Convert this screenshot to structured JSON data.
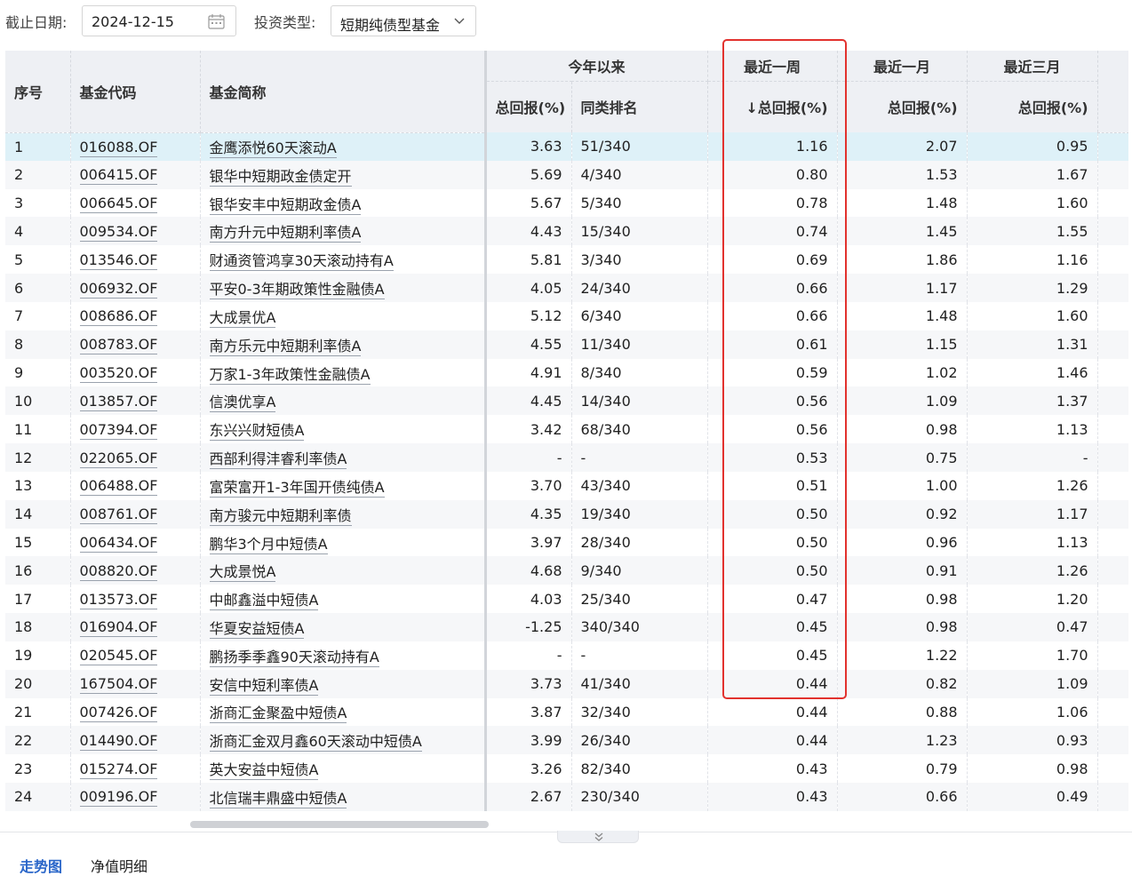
{
  "filters": {
    "date_label": "截止日期:",
    "date_value": "2024-12-15",
    "type_label": "投资类型:",
    "type_value": "短期纯债型基金"
  },
  "header": {
    "col_index": "序号",
    "col_code": "基金代码",
    "col_name": "基金简称",
    "group_ytd": "今年以来",
    "group_week": "最近一周",
    "group_month": "最近一月",
    "group_quarter": "最近三月",
    "sub_ytd_return": "总回报(%)",
    "sub_ytd_rank": "同类排名",
    "sub_week_return": "↓总回报(%)",
    "sub_month_return": "总回报(%)",
    "sub_quarter_return": "总回报(%)"
  },
  "rows": [
    {
      "idx": "1",
      "code": "016088.OF",
      "name": "金鹰添悦60天滚动A",
      "ytd": "3.63",
      "rank": "51/340",
      "week": "1.16",
      "month": "2.07",
      "quarter": "0.95"
    },
    {
      "idx": "2",
      "code": "006415.OF",
      "name": "银华中短期政金债定开",
      "ytd": "5.69",
      "rank": "4/340",
      "week": "0.80",
      "month": "1.53",
      "quarter": "1.67"
    },
    {
      "idx": "3",
      "code": "006645.OF",
      "name": "银华安丰中短期政金债A",
      "ytd": "5.67",
      "rank": "5/340",
      "week": "0.78",
      "month": "1.48",
      "quarter": "1.60"
    },
    {
      "idx": "4",
      "code": "009534.OF",
      "name": "南方升元中短期利率债A",
      "ytd": "4.43",
      "rank": "15/340",
      "week": "0.74",
      "month": "1.45",
      "quarter": "1.55"
    },
    {
      "idx": "5",
      "code": "013546.OF",
      "name": "财通资管鸿享30天滚动持有A",
      "ytd": "5.81",
      "rank": "3/340",
      "week": "0.69",
      "month": "1.86",
      "quarter": "1.16"
    },
    {
      "idx": "6",
      "code": "006932.OF",
      "name": "平安0-3年期政策性金融债A",
      "ytd": "4.05",
      "rank": "24/340",
      "week": "0.66",
      "month": "1.17",
      "quarter": "1.29"
    },
    {
      "idx": "7",
      "code": "008686.OF",
      "name": "大成景优A",
      "ytd": "5.12",
      "rank": "6/340",
      "week": "0.66",
      "month": "1.48",
      "quarter": "1.60"
    },
    {
      "idx": "8",
      "code": "008783.OF",
      "name": "南方乐元中短期利率债A",
      "ytd": "4.55",
      "rank": "11/340",
      "week": "0.61",
      "month": "1.15",
      "quarter": "1.31"
    },
    {
      "idx": "9",
      "code": "003520.OF",
      "name": "万家1-3年政策性金融债A",
      "ytd": "4.91",
      "rank": "8/340",
      "week": "0.59",
      "month": "1.02",
      "quarter": "1.46"
    },
    {
      "idx": "10",
      "code": "013857.OF",
      "name": "信澳优享A",
      "ytd": "4.45",
      "rank": "14/340",
      "week": "0.56",
      "month": "1.09",
      "quarter": "1.37"
    },
    {
      "idx": "11",
      "code": "007394.OF",
      "name": "东兴兴财短债A",
      "ytd": "3.42",
      "rank": "68/340",
      "week": "0.56",
      "month": "0.98",
      "quarter": "1.13"
    },
    {
      "idx": "12",
      "code": "022065.OF",
      "name": "西部利得沣睿利率债A",
      "ytd": "-",
      "rank": "-",
      "week": "0.53",
      "month": "0.75",
      "quarter": "-"
    },
    {
      "idx": "13",
      "code": "006488.OF",
      "name": "富荣富开1-3年国开债纯债A",
      "ytd": "3.70",
      "rank": "43/340",
      "week": "0.51",
      "month": "1.00",
      "quarter": "1.26"
    },
    {
      "idx": "14",
      "code": "008761.OF",
      "name": "南方骏元中短期利率债",
      "ytd": "4.35",
      "rank": "19/340",
      "week": "0.50",
      "month": "0.92",
      "quarter": "1.17"
    },
    {
      "idx": "15",
      "code": "006434.OF",
      "name": "鹏华3个月中短债A",
      "ytd": "3.97",
      "rank": "28/340",
      "week": "0.50",
      "month": "0.96",
      "quarter": "1.13"
    },
    {
      "idx": "16",
      "code": "008820.OF",
      "name": "大成景悦A",
      "ytd": "4.68",
      "rank": "9/340",
      "week": "0.50",
      "month": "0.91",
      "quarter": "1.26"
    },
    {
      "idx": "17",
      "code": "013573.OF",
      "name": "中邮鑫溢中短债A",
      "ytd": "4.03",
      "rank": "25/340",
      "week": "0.47",
      "month": "0.98",
      "quarter": "1.20"
    },
    {
      "idx": "18",
      "code": "016904.OF",
      "name": "华夏安益短债A",
      "ytd": "-1.25",
      "rank": "340/340",
      "week": "0.45",
      "month": "0.98",
      "quarter": "0.47"
    },
    {
      "idx": "19",
      "code": "020545.OF",
      "name": "鹏扬季季鑫90天滚动持有A",
      "ytd": "-",
      "rank": "-",
      "week": "0.45",
      "month": "1.22",
      "quarter": "1.70"
    },
    {
      "idx": "20",
      "code": "167504.OF",
      "name": "安信中短利率债A",
      "ytd": "3.73",
      "rank": "41/340",
      "week": "0.44",
      "month": "0.82",
      "quarter": "1.09"
    },
    {
      "idx": "21",
      "code": "007426.OF",
      "name": "浙商汇金聚盈中短债A",
      "ytd": "3.87",
      "rank": "32/340",
      "week": "0.44",
      "month": "0.88",
      "quarter": "1.06"
    },
    {
      "idx": "22",
      "code": "014490.OF",
      "name": "浙商汇金双月鑫60天滚动中短债A",
      "ytd": "3.99",
      "rank": "26/340",
      "week": "0.44",
      "month": "1.23",
      "quarter": "0.93"
    },
    {
      "idx": "23",
      "code": "015274.OF",
      "name": "英大安益中短债A",
      "ytd": "3.26",
      "rank": "82/340",
      "week": "0.43",
      "month": "0.79",
      "quarter": "0.98"
    },
    {
      "idx": "24",
      "code": "009196.OF",
      "name": "北信瑞丰鼎盛中短债A",
      "ytd": "2.67",
      "rank": "230/340",
      "week": "0.43",
      "month": "0.66",
      "quarter": "0.49"
    }
  ],
  "tabs": {
    "trend": "走势图",
    "nav": "净值明细"
  }
}
